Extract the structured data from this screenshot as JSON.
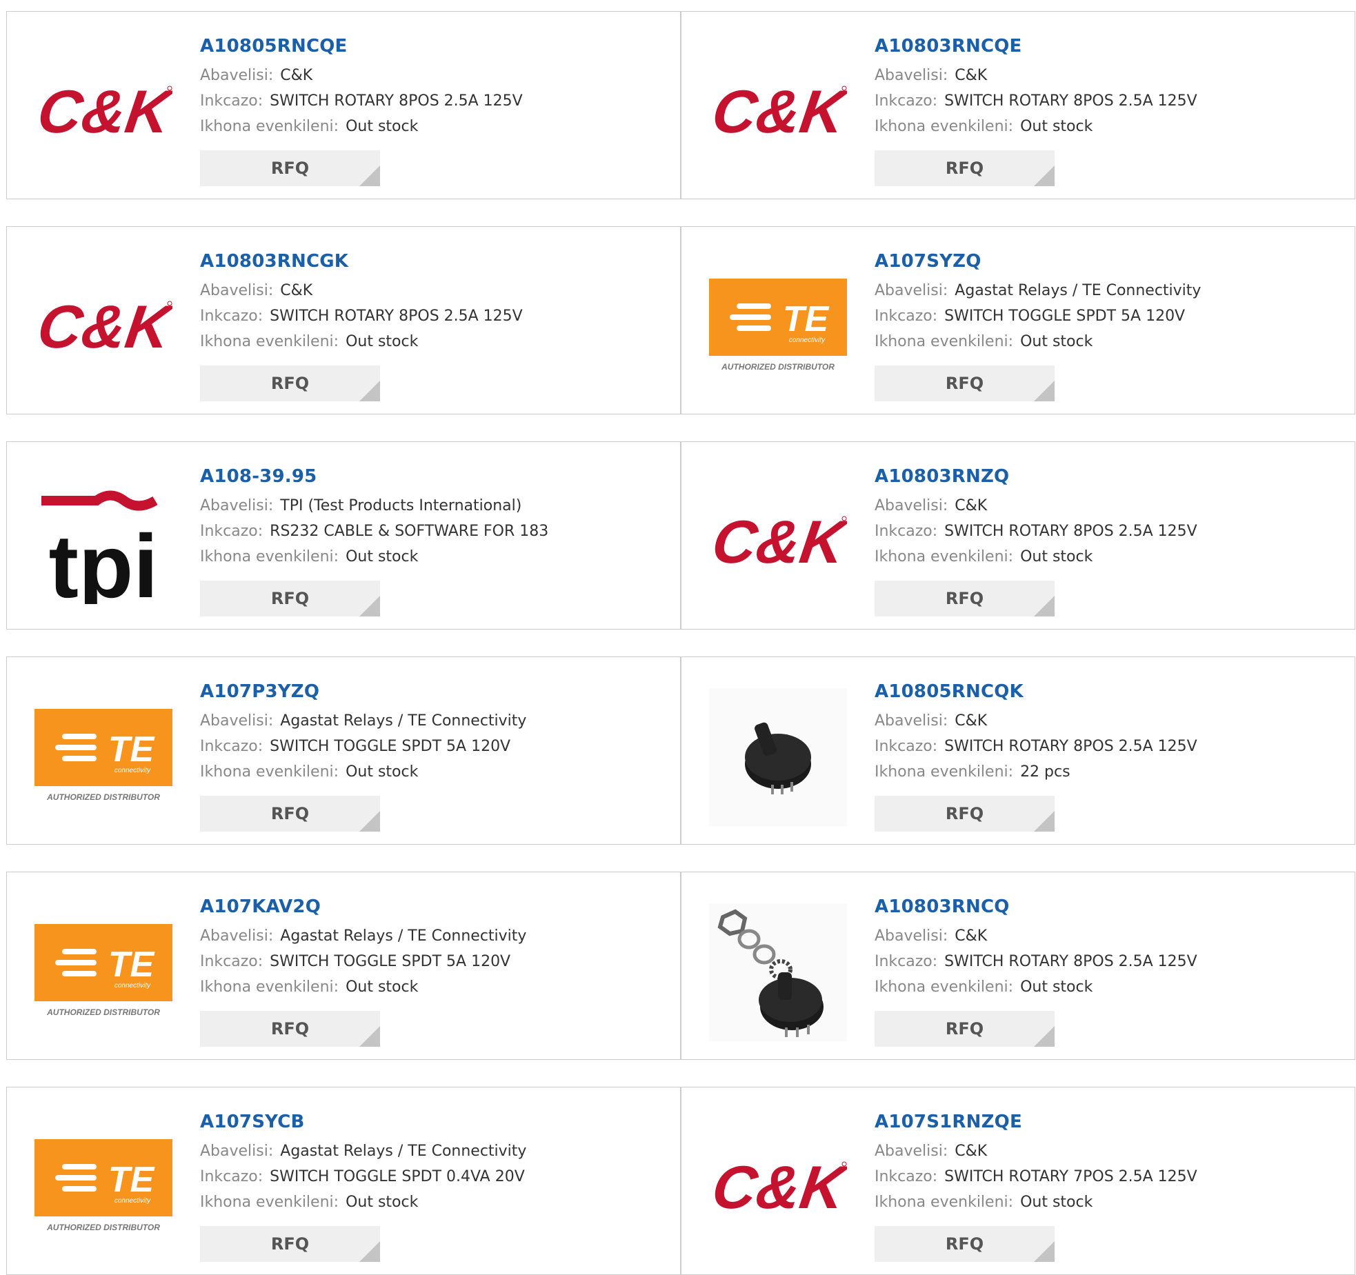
{
  "labels": {
    "manufacturer": "Abavelisi:",
    "description": "Inkcazo:",
    "stock": "Ikhona evenkileni:",
    "rfq": "RFQ"
  },
  "logo_text": {
    "ck": "C&K",
    "te": "TE",
    "te_sub": "connectivity",
    "te_badge": "AUTHORIZED DISTRIBUTOR",
    "tpi": "tpi"
  },
  "products": [
    {
      "part": "A10805RNCQE",
      "manufacturer": "C&K",
      "description": "SWITCH ROTARY 8POS 2.5A 125V",
      "stock": "Out stock",
      "image": "ck-logo"
    },
    {
      "part": "A10803RNCQE",
      "manufacturer": "C&K",
      "description": "SWITCH ROTARY 8POS 2.5A 125V",
      "stock": "Out stock",
      "image": "ck-logo"
    },
    {
      "part": "A10803RNCGK",
      "manufacturer": "C&K",
      "description": "SWITCH ROTARY 8POS 2.5A 125V",
      "stock": "Out stock",
      "image": "ck-logo"
    },
    {
      "part": "A107SYZQ",
      "manufacturer": "Agastat Relays / TE Connectivity",
      "description": "SWITCH TOGGLE SPDT 5A 120V",
      "stock": "Out stock",
      "image": "te-logo"
    },
    {
      "part": "A108-39.95",
      "manufacturer": "TPI (Test Products International)",
      "description": "RS232 CABLE & SOFTWARE FOR 183",
      "stock": "Out stock",
      "image": "tpi-logo"
    },
    {
      "part": "A10803RNZQ",
      "manufacturer": "C&K",
      "description": "SWITCH ROTARY 8POS 2.5A 125V",
      "stock": "Out stock",
      "image": "ck-logo"
    },
    {
      "part": "A107P3YZQ",
      "manufacturer": "Agastat Relays / TE Connectivity",
      "description": "SWITCH TOGGLE SPDT 5A 120V",
      "stock": "Out stock",
      "image": "te-logo"
    },
    {
      "part": "A10805RNCQK",
      "manufacturer": "C&K",
      "description": "SWITCH ROTARY 8POS 2.5A 125V",
      "stock": "22 pcs",
      "image": "rotary-switch-photo"
    },
    {
      "part": "A107KAV2Q",
      "manufacturer": "Agastat Relays / TE Connectivity",
      "description": "SWITCH TOGGLE SPDT 5A 120V",
      "stock": "Out stock",
      "image": "te-logo"
    },
    {
      "part": "A10803RNCQ",
      "manufacturer": "C&K",
      "description": "SWITCH ROTARY 8POS 2.5A 125V",
      "stock": "Out stock",
      "image": "rotary-switch-hardware-photo"
    },
    {
      "part": "A107SYCB",
      "manufacturer": "Agastat Relays / TE Connectivity",
      "description": "SWITCH TOGGLE SPDT 0.4VA 20V",
      "stock": "Out stock",
      "image": "te-logo"
    },
    {
      "part": "A107S1RNZQE",
      "manufacturer": "C&K",
      "description": "SWITCH ROTARY 7POS 2.5A 125V",
      "stock": "Out stock",
      "image": "ck-logo"
    }
  ],
  "colors": {
    "part_link": "#1a5fa8",
    "ck_red": "#c4122f",
    "te_orange": "#f7941d",
    "border": "#cccccc",
    "rfq_bg": "#efefef"
  }
}
